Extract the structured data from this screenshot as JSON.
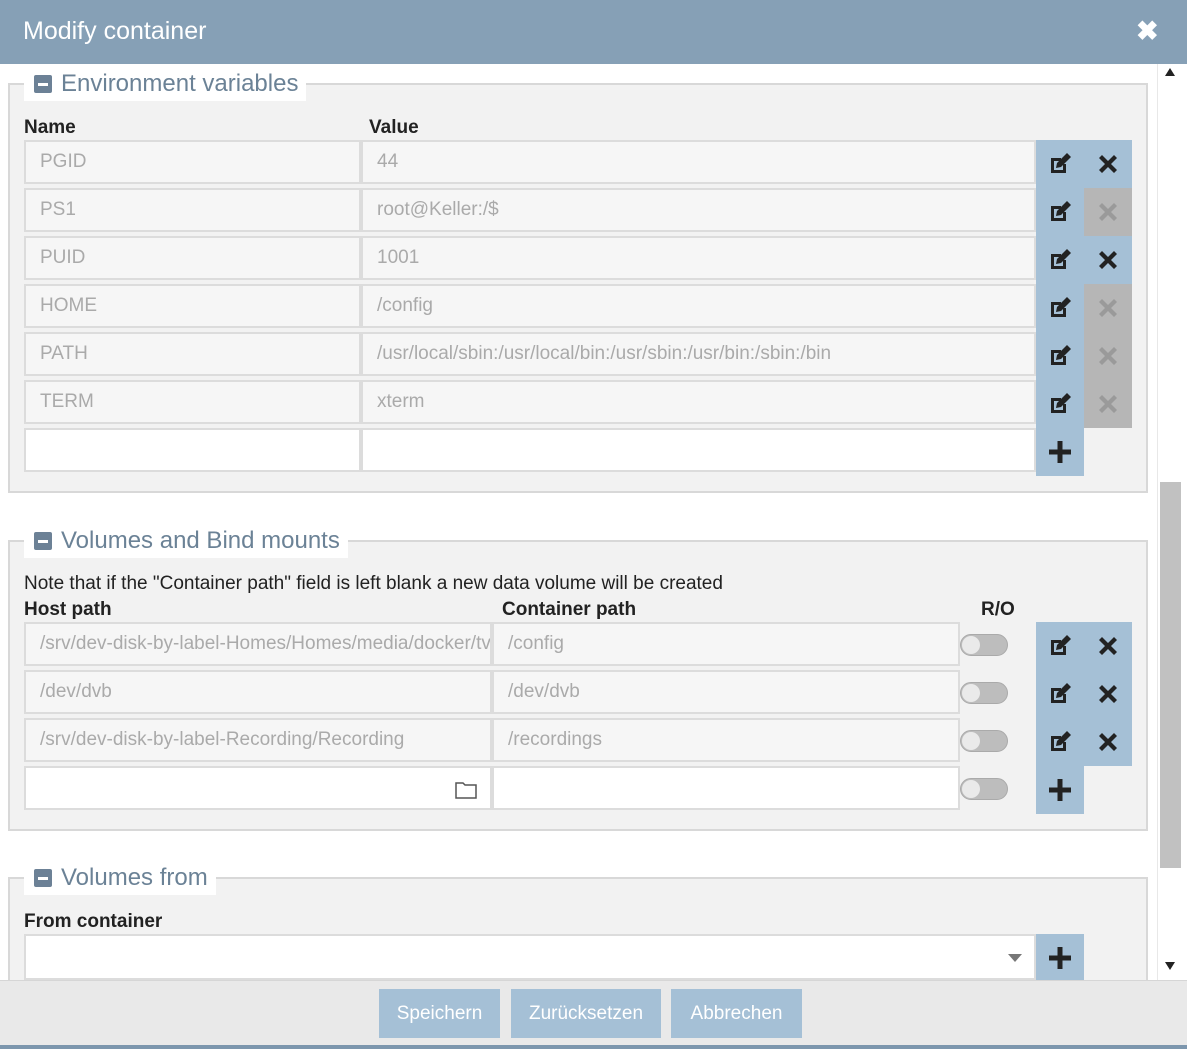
{
  "dialog": {
    "title": "Modify container"
  },
  "env": {
    "legend": "Environment variables",
    "col_name": "Name",
    "col_value": "Value",
    "rows": [
      {
        "name": "PGID",
        "value": "44",
        "deletable": true
      },
      {
        "name": "PS1",
        "value": "root@Keller:/$",
        "deletable": false
      },
      {
        "name": "PUID",
        "value": "1001",
        "deletable": true
      },
      {
        "name": "HOME",
        "value": "/config",
        "deletable": false
      },
      {
        "name": "PATH",
        "value": "/usr/local/sbin:/usr/local/bin:/usr/sbin:/usr/bin:/sbin:/bin",
        "deletable": false
      },
      {
        "name": "TERM",
        "value": "xterm",
        "deletable": false
      }
    ],
    "new_name": "",
    "new_value": ""
  },
  "volumes": {
    "legend": "Volumes and Bind mounts",
    "note": "Note that if the \"Container path\" field is left blank a new data volume will be created",
    "col_host": "Host path",
    "col_container": "Container path",
    "col_ro": "R/O",
    "rows": [
      {
        "host": "/srv/dev-disk-by-label-Homes/Homes/media/docker/tvheadend",
        "container": "/config",
        "ro": false
      },
      {
        "host": "/dev/dvb",
        "container": "/dev/dvb",
        "ro": false
      },
      {
        "host": "/srv/dev-disk-by-label-Recording/Recording",
        "container": "/recordings",
        "ro": false
      }
    ],
    "new_host": "",
    "new_container": "",
    "new_ro": false
  },
  "volumes_from": {
    "legend": "Volumes from",
    "col_from": "From container",
    "selected": ""
  },
  "footer": {
    "save": "Speichern",
    "reset": "Zurücksetzen",
    "cancel": "Abbrechen"
  },
  "colors": {
    "titlebar": "#86a0b6",
    "button_blue": "#a5c0d6",
    "button_disabled": "#b6b6b6",
    "legend_text": "#6b8296"
  },
  "icons": {
    "close": "close-icon",
    "edit": "edit-icon",
    "delete": "delete-icon",
    "add": "plus-icon",
    "folder": "folder-icon",
    "collapse": "minus-icon"
  }
}
